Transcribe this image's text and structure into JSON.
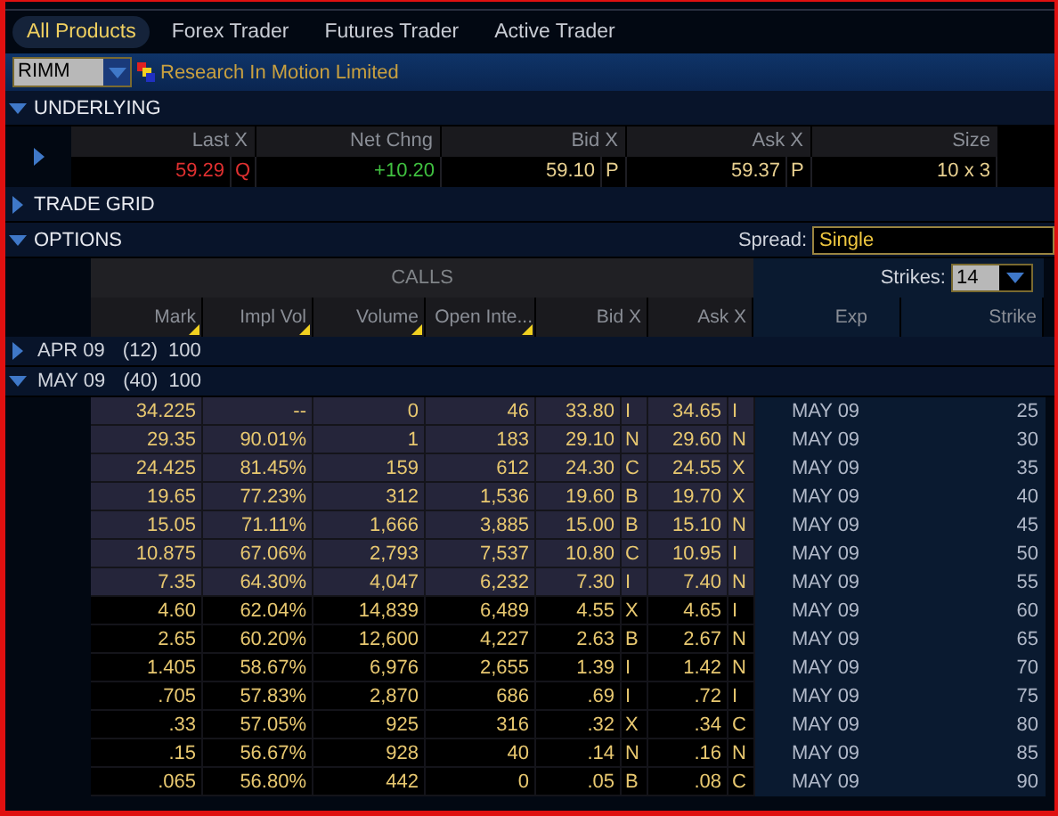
{
  "tabs": [
    {
      "label": "All Products",
      "selected": true
    },
    {
      "label": "Forex Trader",
      "selected": false
    },
    {
      "label": "Futures Trader",
      "selected": false
    },
    {
      "label": "Active Trader",
      "selected": false
    }
  ],
  "symbol": {
    "value": "RIMM",
    "description": "Research In Motion Limited"
  },
  "underlying": {
    "title": "UNDERLYING",
    "expanded": true,
    "columns": [
      "Last X",
      "Net Chng",
      "Bid X",
      "Ask X",
      "Size"
    ],
    "row": {
      "last": "59.29",
      "last_exchange": "Q",
      "net_change": "+10.20",
      "bid": "59.10",
      "bid_exchange": "P",
      "ask": "59.37",
      "ask_exchange": "P",
      "size": "10 x 3"
    }
  },
  "trade_grid": {
    "title": "TRADE GRID",
    "expanded": false
  },
  "options": {
    "title": "OPTIONS",
    "expanded": true,
    "spread_label": "Spread:",
    "spread": "Single",
    "group_title": "CALLS",
    "strikes_label": "Strikes:",
    "strikes": "14",
    "columns": [
      {
        "label": "Mark",
        "sortable": true
      },
      {
        "label": "Impl Vol",
        "sortable": true
      },
      {
        "label": "Volume",
        "sortable": true
      },
      {
        "label": "Open Inte...",
        "sortable": true
      },
      {
        "label": "Bid X",
        "sortable": false
      },
      {
        "label": "Ask X",
        "sortable": false
      },
      {
        "label": "Exp",
        "sortable": false
      },
      {
        "label": "Strike",
        "sortable": false
      }
    ],
    "series": [
      {
        "label": "APR 09",
        "count": "(12)",
        "multiplier": "100",
        "expanded": false
      },
      {
        "label": "MAY 09",
        "count": "(40)",
        "multiplier": "100",
        "expanded": true
      }
    ],
    "rows": [
      {
        "mark": "34.225",
        "impl_vol": "--",
        "volume": "0",
        "open_interest": "46",
        "bid": "33.80",
        "bid_exchange": "I",
        "ask": "34.65",
        "ask_exchange": "I",
        "exp": "MAY 09",
        "strike": "25",
        "in_the_money": true
      },
      {
        "mark": "29.35",
        "impl_vol": "90.01%",
        "volume": "1",
        "open_interest": "183",
        "bid": "29.10",
        "bid_exchange": "N",
        "ask": "29.60",
        "ask_exchange": "N",
        "exp": "MAY 09",
        "strike": "30",
        "in_the_money": true
      },
      {
        "mark": "24.425",
        "impl_vol": "81.45%",
        "volume": "159",
        "open_interest": "612",
        "bid": "24.30",
        "bid_exchange": "C",
        "ask": "24.55",
        "ask_exchange": "X",
        "exp": "MAY 09",
        "strike": "35",
        "in_the_money": true
      },
      {
        "mark": "19.65",
        "impl_vol": "77.23%",
        "volume": "312",
        "open_interest": "1,536",
        "bid": "19.60",
        "bid_exchange": "B",
        "ask": "19.70",
        "ask_exchange": "X",
        "exp": "MAY 09",
        "strike": "40",
        "in_the_money": true
      },
      {
        "mark": "15.05",
        "impl_vol": "71.11%",
        "volume": "1,666",
        "open_interest": "3,885",
        "bid": "15.00",
        "bid_exchange": "B",
        "ask": "15.10",
        "ask_exchange": "N",
        "exp": "MAY 09",
        "strike": "45",
        "in_the_money": true
      },
      {
        "mark": "10.875",
        "impl_vol": "67.06%",
        "volume": "2,793",
        "open_interest": "7,537",
        "bid": "10.80",
        "bid_exchange": "C",
        "ask": "10.95",
        "ask_exchange": "I",
        "exp": "MAY 09",
        "strike": "50",
        "in_the_money": true
      },
      {
        "mark": "7.35",
        "impl_vol": "64.30%",
        "volume": "4,047",
        "open_interest": "6,232",
        "bid": "7.30",
        "bid_exchange": "I",
        "ask": "7.40",
        "ask_exchange": "N",
        "exp": "MAY 09",
        "strike": "55",
        "in_the_money": true
      },
      {
        "mark": "4.60",
        "impl_vol": "62.04%",
        "volume": "14,839",
        "open_interest": "6,489",
        "bid": "4.55",
        "bid_exchange": "X",
        "ask": "4.65",
        "ask_exchange": "I",
        "exp": "MAY 09",
        "strike": "60",
        "in_the_money": false
      },
      {
        "mark": "2.65",
        "impl_vol": "60.20%",
        "volume": "12,600",
        "open_interest": "4,227",
        "bid": "2.63",
        "bid_exchange": "B",
        "ask": "2.67",
        "ask_exchange": "N",
        "exp": "MAY 09",
        "strike": "65",
        "in_the_money": false
      },
      {
        "mark": "1.405",
        "impl_vol": "58.67%",
        "volume": "6,976",
        "open_interest": "2,655",
        "bid": "1.39",
        "bid_exchange": "I",
        "ask": "1.42",
        "ask_exchange": "N",
        "exp": "MAY 09",
        "strike": "70",
        "in_the_money": false
      },
      {
        "mark": ".705",
        "impl_vol": "57.83%",
        "volume": "2,870",
        "open_interest": "686",
        "bid": ".69",
        "bid_exchange": "I",
        "ask": ".72",
        "ask_exchange": "I",
        "exp": "MAY 09",
        "strike": "75",
        "in_the_money": false
      },
      {
        "mark": ".33",
        "impl_vol": "57.05%",
        "volume": "925",
        "open_interest": "316",
        "bid": ".32",
        "bid_exchange": "X",
        "ask": ".34",
        "ask_exchange": "C",
        "exp": "MAY 09",
        "strike": "80",
        "in_the_money": false
      },
      {
        "mark": ".15",
        "impl_vol": "56.67%",
        "volume": "928",
        "open_interest": "40",
        "bid": ".14",
        "bid_exchange": "N",
        "ask": ".16",
        "ask_exchange": "N",
        "exp": "MAY 09",
        "strike": "85",
        "in_the_money": false
      },
      {
        "mark": ".065",
        "impl_vol": "56.80%",
        "volume": "442",
        "open_interest": "0",
        "bid": ".05",
        "bid_exchange": "B",
        "ask": ".08",
        "ask_exchange": "C",
        "exp": "MAY 09",
        "strike": "90",
        "in_the_money": false
      }
    ]
  }
}
